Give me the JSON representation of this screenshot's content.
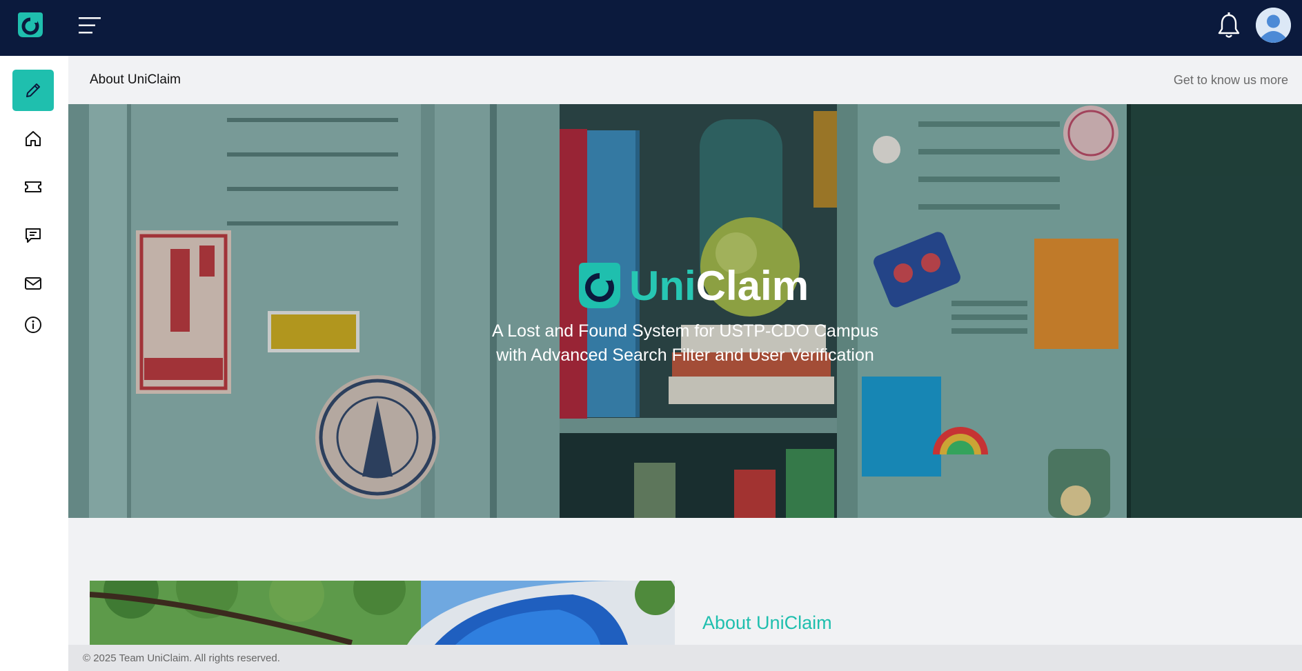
{
  "app": {
    "name": "UniClaim"
  },
  "topbar": {
    "logo_icon": "uniclaim-logo-icon",
    "menu_icon": "hamburger-menu-icon",
    "notification_icon": "bell-icon",
    "profile_icon": "user-avatar-icon"
  },
  "sidebar": {
    "items": [
      {
        "icon": "pencil-icon",
        "active": true
      },
      {
        "icon": "home-icon"
      },
      {
        "icon": "ticket-icon"
      },
      {
        "icon": "message-icon"
      },
      {
        "icon": "mail-icon"
      },
      {
        "icon": "info-icon"
      }
    ]
  },
  "header": {
    "title": "About UniClaim",
    "link": "Get to know us more"
  },
  "hero": {
    "brand_part1": "Uni",
    "brand_part2": "Claim",
    "subtitle_line1": "A Lost and Found System for USTP-CDO Campus",
    "subtitle_line2": "with Advanced Search Filter and User Verification"
  },
  "about": {
    "heading": "About UniClaim"
  },
  "footer": {
    "text": "© 2025 Team UniClaim. All rights reserved."
  },
  "colors": {
    "topbar": "#0b1a3d",
    "accent": "#1fbfae",
    "background": "#f1f2f4"
  }
}
